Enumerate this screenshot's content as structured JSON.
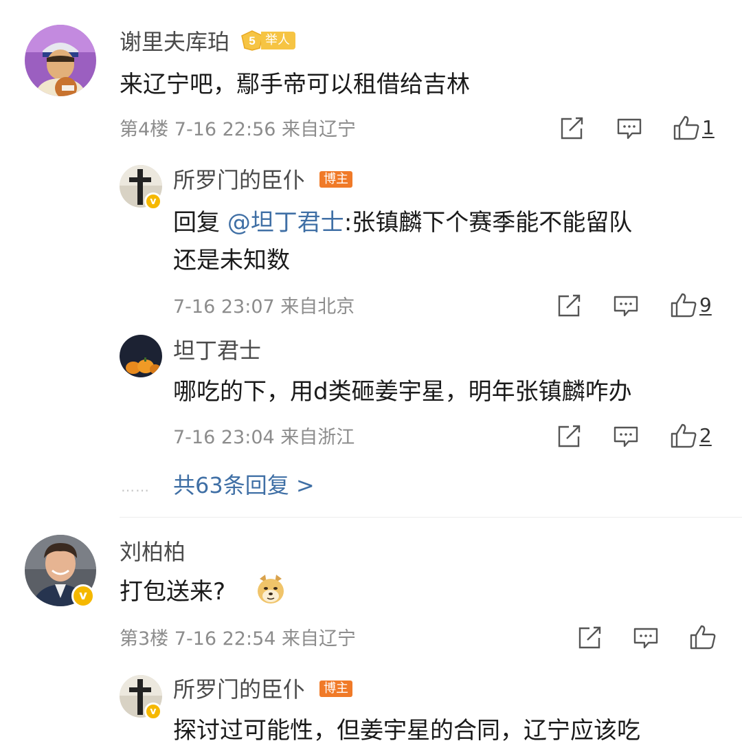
{
  "comments": [
    {
      "username": "谢里夫库珀",
      "level": "5",
      "level_tag": "举人",
      "text": "来辽宁吧，鄢手帝可以租借给吉林",
      "meta": "第4楼 7-16 22:56 来自辽宁",
      "likes": "1",
      "replies": [
        {
          "username": "所罗门的臣仆",
          "badge": "博主",
          "text_prefix": "回复 ",
          "mention": "@坦丁君士",
          "text_line1": ":张镇麟下个赛季能不能留队",
          "text_line2": "还是未知数",
          "meta": "7-16 23:07 来自北京",
          "likes": "9"
        },
        {
          "username": "坦丁君士",
          "text": "哪吃的下，用d类砸姜宇星，明年张镇麟咋办",
          "meta": "7-16 23:04 来自浙江",
          "likes": "2"
        }
      ],
      "more_dots": "……",
      "more_replies": "共63条回复 >"
    },
    {
      "username": "刘柏柏",
      "text": "打包送来?",
      "emoji": "doge-emoji",
      "meta": "第3楼 7-16 22:54 来自辽宁",
      "likes": "",
      "replies": [
        {
          "username": "所罗门的臣仆",
          "badge": "博主",
          "text": "探讨过可能性，但姜宇星的合同，辽宁应该吃"
        }
      ]
    }
  ],
  "icons": {
    "share": "share-icon",
    "comment": "comment-icon",
    "like": "thumbs-up-icon",
    "verified": "verified-v-icon"
  },
  "colors": {
    "link": "#3f6fa5",
    "blogger_badge": "#f07a28",
    "level_badge": "#f6c443",
    "verified": "#f5b800",
    "meta_text": "#8c8c8c"
  }
}
